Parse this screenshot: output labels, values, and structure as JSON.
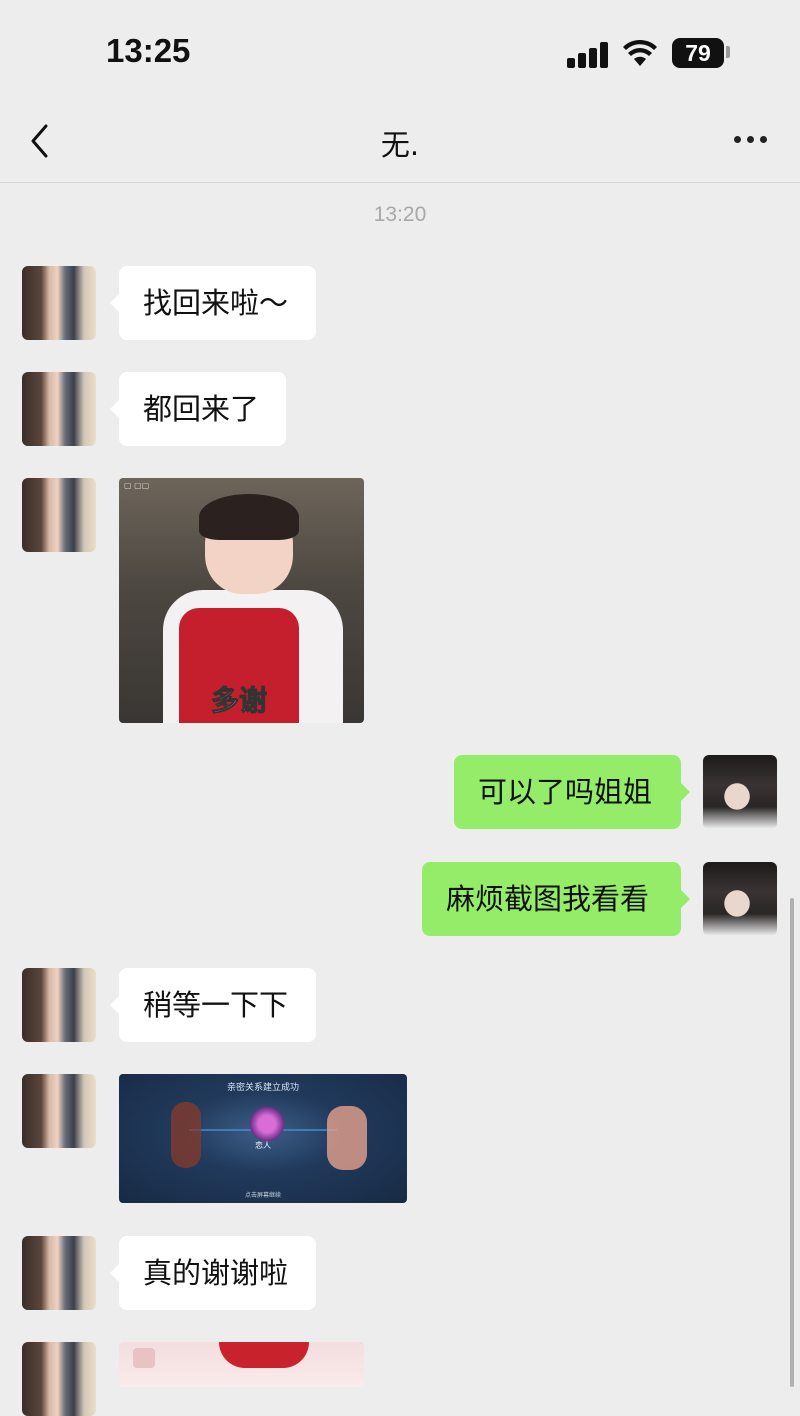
{
  "status_bar": {
    "time": "13:25",
    "battery": "79",
    "icons": [
      "signal-icon",
      "wifi-icon",
      "battery-icon"
    ]
  },
  "nav": {
    "title": "无.",
    "back_icon": "chevron-left-icon",
    "more_icon": "more-icon"
  },
  "chat": {
    "timestamp": "13:20",
    "messages": [
      {
        "side": "left",
        "type": "text",
        "text": "找回来啦～"
      },
      {
        "side": "left",
        "type": "text",
        "text": "都回来了"
      },
      {
        "side": "left",
        "type": "sticker",
        "caption": "多谢"
      },
      {
        "side": "right",
        "type": "text",
        "text": "可以了吗姐姐"
      },
      {
        "side": "right",
        "type": "text",
        "text": "麻烦截图我看看"
      },
      {
        "side": "left",
        "type": "text",
        "text": "稍等一下下"
      },
      {
        "side": "left",
        "type": "image",
        "header": "亲密关系建立成功",
        "relation": "恋人",
        "footer": "点击屏幕继续"
      },
      {
        "side": "left",
        "type": "text",
        "text": "真的谢谢啦"
      },
      {
        "side": "left",
        "type": "image"
      }
    ]
  },
  "colors": {
    "background": "#ededed",
    "incoming_bubble": "#ffffff",
    "outgoing_bubble": "#95ec69",
    "timestamp": "#a8a8a8"
  }
}
